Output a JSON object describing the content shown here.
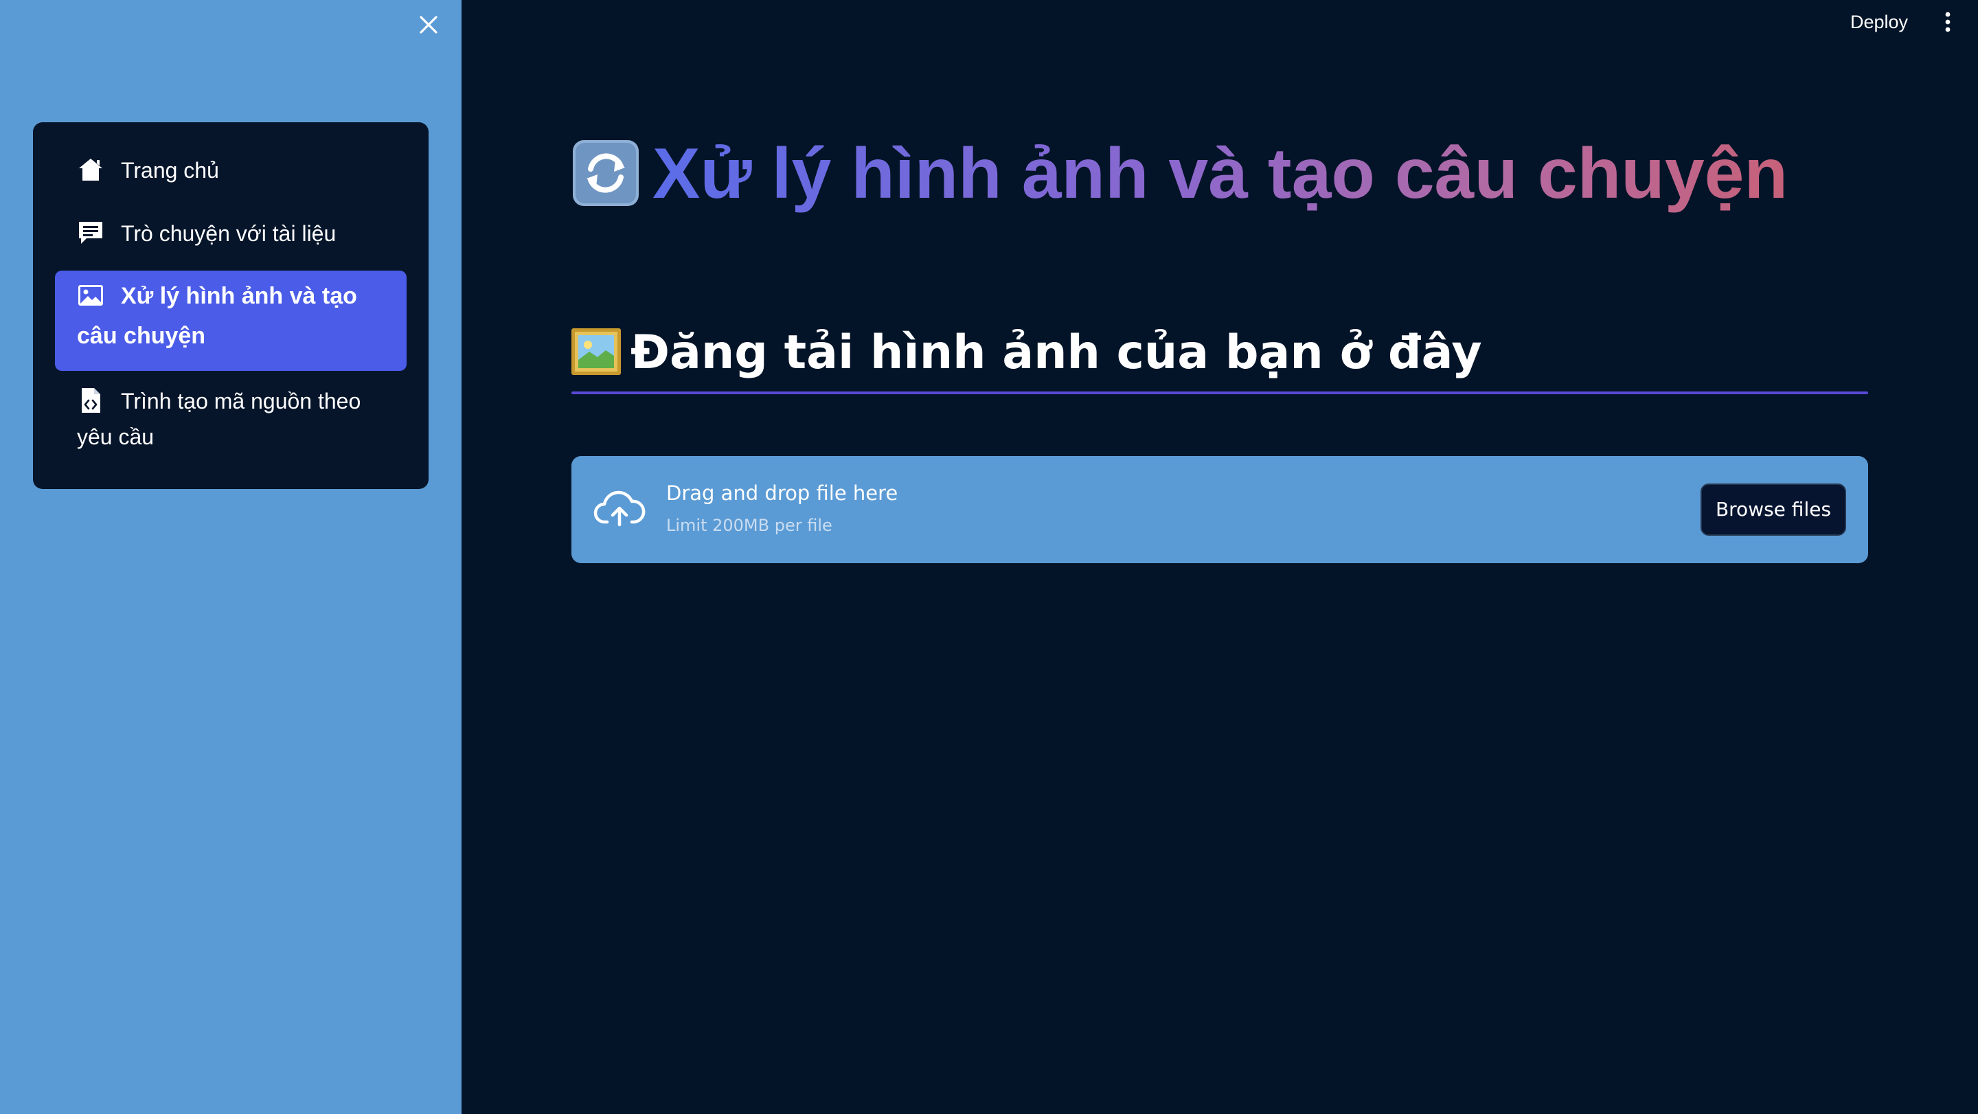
{
  "sidebar": {
    "close_icon": "close-icon",
    "items": [
      {
        "label": "Trang chủ",
        "icon": "home-icon",
        "active": false
      },
      {
        "label": "Trò chuyện với tài liệu",
        "icon": "chat-icon",
        "active": false
      },
      {
        "label": "Xử lý hình ảnh và tạo câu chuyện",
        "icon": "image-icon",
        "active": true
      },
      {
        "label": "Trình tạo mã nguồn theo yêu cầu",
        "icon": "code-file-icon",
        "active": false
      }
    ]
  },
  "header": {
    "deploy_label": "Deploy",
    "menu_icon": "more-vertical-icon"
  },
  "main": {
    "title_icon": "refresh-emoji-icon",
    "title": "Xử lý hình ảnh và tạo câu chuyện",
    "subheader_icon": "framed-picture-emoji-icon",
    "subheader": "Đăng tải hình ảnh của bạn ở đây",
    "uploader": {
      "icon": "cloud-upload-icon",
      "drop_text": "Drag and drop file here",
      "limit_text": "Limit 200MB per file",
      "browse_label": "Browse files"
    }
  },
  "colors": {
    "background": "#041428",
    "sidebar": "#5b9bd5",
    "nav_card": "#06152a",
    "active_item": "#4b5ce8",
    "divider": "#5a48d8",
    "title_gradient": [
      "#5b6ce8",
      "#8a67cf",
      "#b36aa2",
      "#c7617a"
    ]
  }
}
